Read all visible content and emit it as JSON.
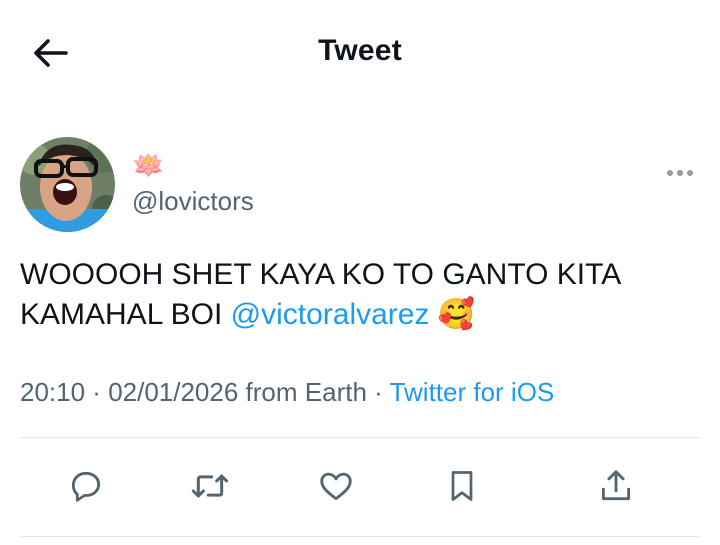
{
  "header": {
    "title": "Tweet",
    "back_icon": "arrow-left-icon"
  },
  "author": {
    "display_name": "🪷",
    "handle": "@lovictors",
    "more_icon": "more-dots-icon"
  },
  "tweet": {
    "text_line1": "WOOOOH SHET KAYA KO TO GANTO KITA",
    "text_line2_prefix": "KAMAHAL BOI ",
    "mention": "@victoralvarez",
    "emoji": "🥰"
  },
  "meta": {
    "time": "20:10",
    "sep1": " · ",
    "date": "02/01/2026",
    "location": " from Earth",
    "sep2": " · ",
    "source": "Twitter for iOS"
  },
  "actions": {
    "reply_icon": "reply-icon",
    "retweet_icon": "retweet-icon",
    "like_icon": "heart-icon",
    "bookmark_icon": "bookmark-icon",
    "share_icon": "share-icon"
  },
  "colors": {
    "accent": "#1d9bf0",
    "secondary": "#536471",
    "text": "#0f1419",
    "divider": "#e1e8ed"
  }
}
